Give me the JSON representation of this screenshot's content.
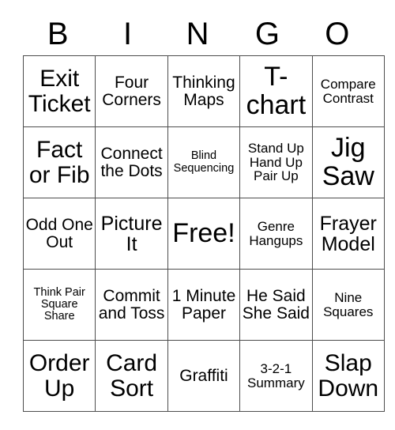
{
  "card": {
    "title_letters": [
      "B",
      "I",
      "N",
      "G",
      "O"
    ],
    "columns": 5,
    "rows": 5,
    "free_space_label": "Free!",
    "free_space_position": {
      "row": 3,
      "column": 3
    },
    "grid_line_color": "#4d4d4d",
    "background_color": "#ffffff",
    "text_color": "#000000",
    "cells": [
      [
        {
          "text": "Exit Ticket",
          "size": "s-xl"
        },
        {
          "text": "Four Corners",
          "size": "s-md"
        },
        {
          "text": "Thinking Maps",
          "size": "s-md"
        },
        {
          "text": "T-chart",
          "size": "s-xxl"
        },
        {
          "text": "Compare Contrast",
          "size": "s-sm"
        }
      ],
      [
        {
          "text": "Fact or Fib",
          "size": "s-xl"
        },
        {
          "text": "Connect the Dots",
          "size": "s-md"
        },
        {
          "text": "Blind Sequencing",
          "size": "s-xs"
        },
        {
          "text": "Stand Up Hand Up Pair Up",
          "size": "s-sm"
        },
        {
          "text": "Jig Saw",
          "size": "s-xxl"
        }
      ],
      [
        {
          "text": "Odd One Out",
          "size": "s-md"
        },
        {
          "text": "Picture It",
          "size": "s-lg"
        },
        {
          "text": "Free!",
          "size": "s-xxl"
        },
        {
          "text": "Genre Hangups",
          "size": "s-sm"
        },
        {
          "text": "Frayer Model",
          "size": "s-lg"
        }
      ],
      [
        {
          "text": "Think Pair Square Share",
          "size": "s-xs"
        },
        {
          "text": "Commit and Toss",
          "size": "s-md"
        },
        {
          "text": "1 Minute Paper",
          "size": "s-md"
        },
        {
          "text": "He Said She Said",
          "size": "s-md"
        },
        {
          "text": "Nine Squares",
          "size": "s-sm"
        }
      ],
      [
        {
          "text": "Order Up",
          "size": "s-xl"
        },
        {
          "text": "Card Sort",
          "size": "s-xl"
        },
        {
          "text": "Graffiti",
          "size": "s-md"
        },
        {
          "text": "3-2-1 Summary",
          "size": "s-sm"
        },
        {
          "text": "Slap Down",
          "size": "s-xl"
        }
      ]
    ]
  }
}
